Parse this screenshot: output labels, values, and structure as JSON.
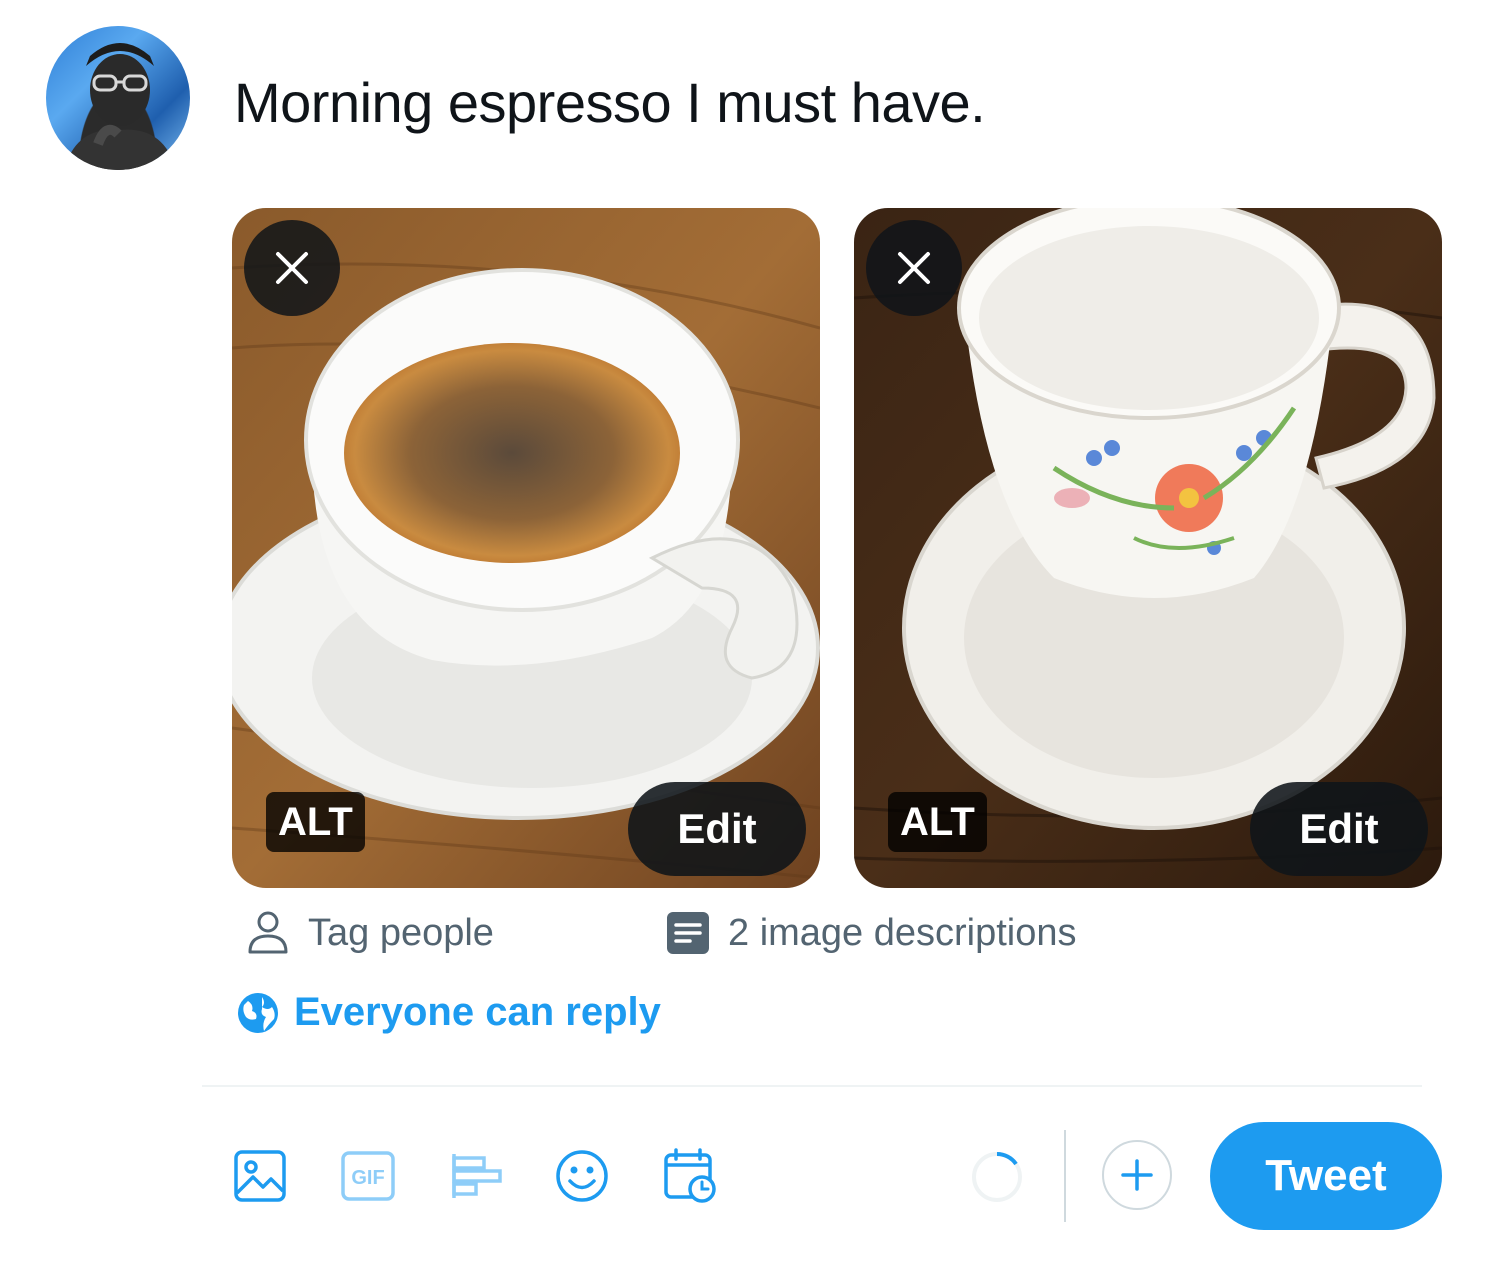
{
  "composer": {
    "text": "Morning espresso I must have."
  },
  "media": [
    {
      "alt_label": "ALT",
      "edit_label": "Edit",
      "remove_icon": "close-icon"
    },
    {
      "alt_label": "ALT",
      "edit_label": "Edit",
      "remove_icon": "close-icon"
    }
  ],
  "actions": {
    "tag_people": "Tag people",
    "image_descriptions": "2 image descriptions"
  },
  "reply_setting": "Everyone can reply",
  "toolbar": {
    "icons": [
      "image-icon",
      "gif-icon",
      "poll-icon",
      "emoji-icon",
      "schedule-icon"
    ],
    "gif_text": "GIF",
    "tweet_label": "Tweet"
  },
  "colors": {
    "accent": "#1d9bf0",
    "secondary_text": "#536471"
  }
}
